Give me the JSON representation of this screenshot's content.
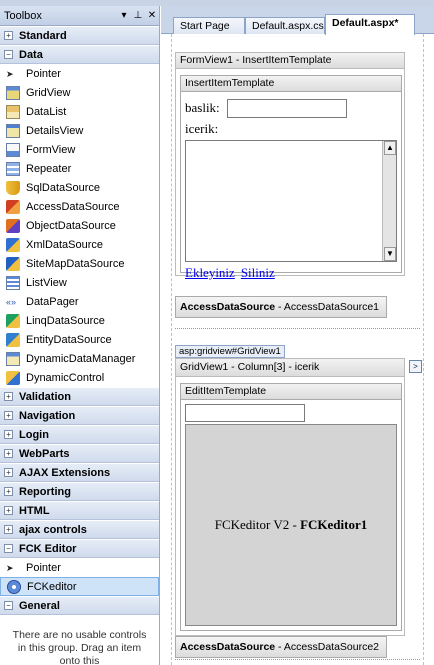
{
  "toolbox": {
    "title": "Toolbox",
    "pin_glyph": "▾ ⊥",
    "close_glyph": "✕",
    "groups_top": [
      {
        "label": "Standard",
        "state": "+"
      },
      {
        "label": "Data",
        "state": "−"
      }
    ],
    "data_items": [
      {
        "label": "Pointer",
        "icon": "pointer-icon"
      },
      {
        "label": "GridView",
        "icon": "gridview-icon"
      },
      {
        "label": "DataList",
        "icon": "datalist-icon"
      },
      {
        "label": "DetailsView",
        "icon": "detailsview-icon"
      },
      {
        "label": "FormView",
        "icon": "formview-icon"
      },
      {
        "label": "Repeater",
        "icon": "repeater-icon"
      },
      {
        "label": "SqlDataSource",
        "icon": "sqldatasource-icon"
      },
      {
        "label": "AccessDataSource",
        "icon": "accessdatasource-icon"
      },
      {
        "label": "ObjectDataSource",
        "icon": "objectdatasource-icon"
      },
      {
        "label": "XmlDataSource",
        "icon": "xmldatasource-icon"
      },
      {
        "label": "SiteMapDataSource",
        "icon": "sitemapdatasource-icon"
      },
      {
        "label": "ListView",
        "icon": "listview-icon"
      },
      {
        "label": "DataPager",
        "icon": "datapager-icon"
      },
      {
        "label": "LinqDataSource",
        "icon": "linqdatasource-icon"
      },
      {
        "label": "EntityDataSource",
        "icon": "entitydatasource-icon"
      },
      {
        "label": "DynamicDataManager",
        "icon": "dynamicdatamanager-icon"
      },
      {
        "label": "DynamicControl",
        "icon": "dynamiccontrol-icon"
      }
    ],
    "groups_mid": [
      {
        "label": "Validation",
        "state": "+"
      },
      {
        "label": "Navigation",
        "state": "+"
      },
      {
        "label": "Login",
        "state": "+"
      },
      {
        "label": "WebParts",
        "state": "+"
      },
      {
        "label": "AJAX Extensions",
        "state": "+"
      },
      {
        "label": "Reporting",
        "state": "+"
      },
      {
        "label": "HTML",
        "state": "+"
      },
      {
        "label": "ajax controls",
        "state": "+"
      },
      {
        "label": "FCK Editor",
        "state": "−"
      }
    ],
    "fck_items": [
      {
        "label": "Pointer",
        "icon": "pointer-icon"
      },
      {
        "label": "FCKeditor",
        "icon": "fckeditor-icon"
      }
    ],
    "general": {
      "label": "General",
      "state": "−"
    },
    "empty_note": "There are no usable controls in this group. Drag an item onto this"
  },
  "tabs": [
    {
      "label": "Start Page"
    },
    {
      "label": "Default.aspx.cs"
    },
    {
      "label": "Default.aspx*"
    }
  ],
  "designer": {
    "formview_title": "FormView1 - InsertItemTemplate",
    "insert_template_title": "InsertItemTemplate",
    "baslik_label": "baslik:",
    "icerik_label": "icerik:",
    "link_insert": "Ekleyiniz",
    "link_cancel": "Siliniz",
    "ads1_bold": "AccessDataSource",
    "ads1_rest": " - AccessDataSource1",
    "gridview_tag": "asp:gridview#GridView1",
    "gridview_title": "GridView1 - Column[3] - icerik",
    "smart_tag": ">",
    "edit_template_title": "EditItemTemplate",
    "fck_text": "FCKeditor V2 - ",
    "fck_bold": "FCKeditor1",
    "ads2_bold": "AccessDataSource",
    "ads2_rest": " - AccessDataSource2"
  },
  "colors": {
    "selected": "#cfe3f8",
    "link": "#0000ee",
    "chrome": "#c9d6ea"
  }
}
